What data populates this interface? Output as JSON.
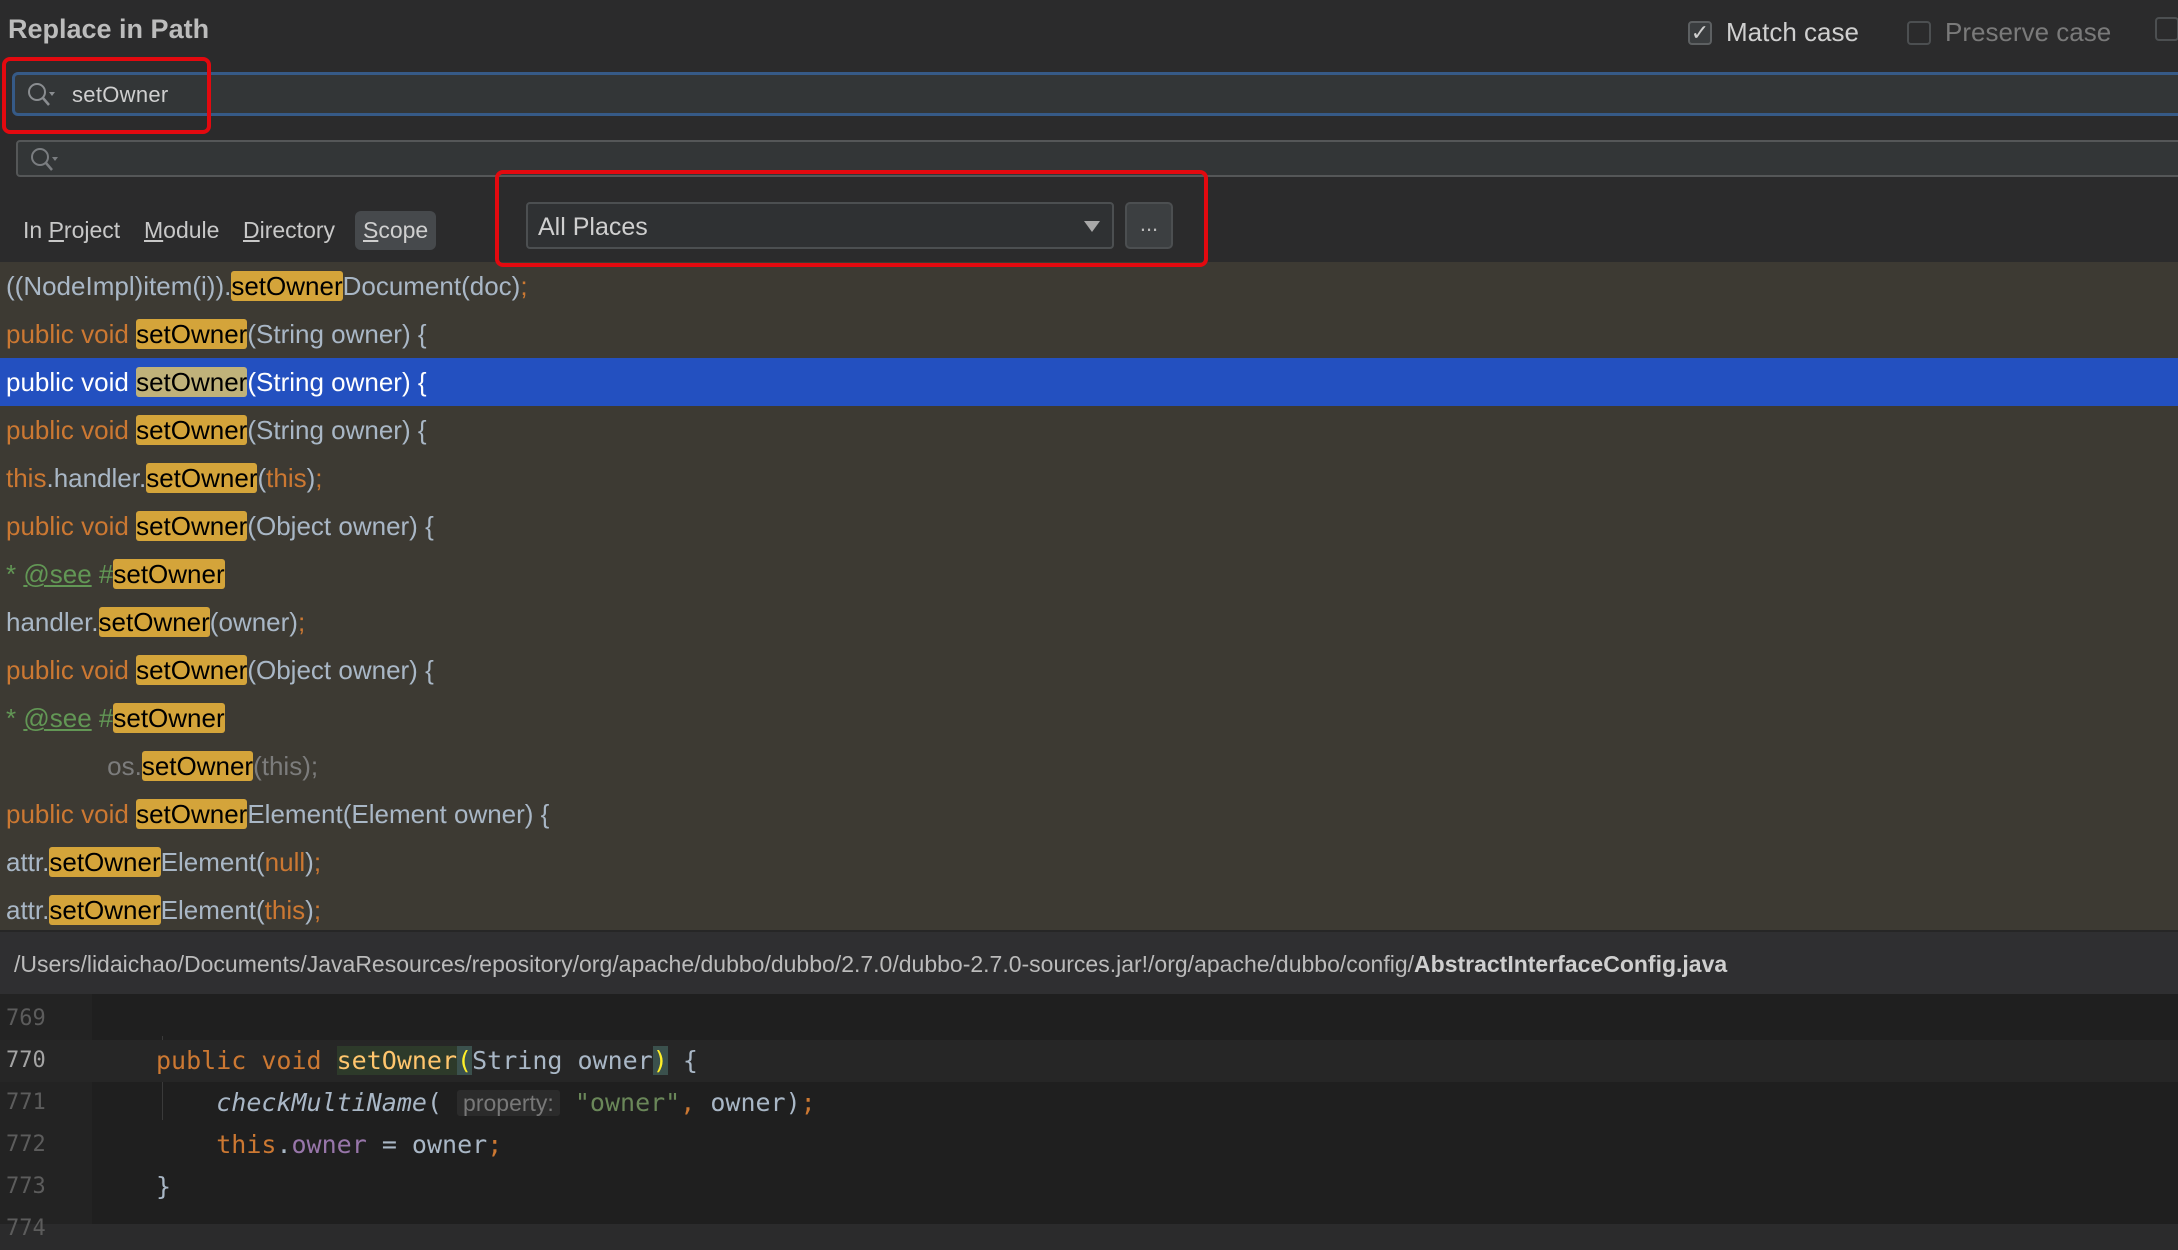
{
  "dialog": {
    "title": "Replace in Path",
    "options": {
      "match_case": {
        "label": "Match case",
        "checked": true
      },
      "preserve_case": {
        "label": "Preserve case",
        "checked": false,
        "enabled": false
      }
    }
  },
  "search": {
    "find_value": "setOwner",
    "replace_value": "",
    "find_icon": "search-history-icon",
    "replace_icon": "search-history-icon"
  },
  "scope": {
    "tabs": [
      {
        "label_pre": "In ",
        "mnemonic": "P",
        "label_post": "roject",
        "active": false
      },
      {
        "label_pre": "",
        "mnemonic": "M",
        "label_post": "odule",
        "active": false
      },
      {
        "label_pre": "",
        "mnemonic": "D",
        "label_post": "irectory",
        "active": false
      },
      {
        "label_pre": "",
        "mnemonic": "S",
        "label_post": "cope",
        "active": true
      }
    ],
    "selected": "All Places",
    "more_button": "..."
  },
  "results": {
    "selected_index": 2,
    "rows": [
      [
        {
          "t": "((NodeImpl)item(i)).",
          "c": "plain"
        },
        {
          "t": "setOwner",
          "c": "hit"
        },
        {
          "t": "Document(doc)",
          "c": "plain"
        },
        {
          "t": ";",
          "c": "kw"
        }
      ],
      [
        {
          "t": "public void ",
          "c": "kw"
        },
        {
          "t": "setOwner",
          "c": "hit"
        },
        {
          "t": "(String owner) {",
          "c": "plain"
        }
      ],
      [
        {
          "t": "public void ",
          "c": "kw"
        },
        {
          "t": "setOwner",
          "c": "hit"
        },
        {
          "t": "(String owner) {",
          "c": "plain"
        }
      ],
      [
        {
          "t": "public void ",
          "c": "kw"
        },
        {
          "t": "setOwner",
          "c": "hit"
        },
        {
          "t": "(String owner) {",
          "c": "plain"
        }
      ],
      [
        {
          "t": "this",
          "c": "kw"
        },
        {
          "t": ".handler.",
          "c": "plain"
        },
        {
          "t": "setOwner",
          "c": "hit"
        },
        {
          "t": "(",
          "c": "plain"
        },
        {
          "t": "this",
          "c": "kw"
        },
        {
          "t": ")",
          "c": "plain"
        },
        {
          "t": ";",
          "c": "kw"
        }
      ],
      [
        {
          "t": "public void ",
          "c": "kw"
        },
        {
          "t": "setOwner",
          "c": "hit"
        },
        {
          "t": "(Object owner) {",
          "c": "plain"
        }
      ],
      [
        {
          "t": "* ",
          "c": "doc"
        },
        {
          "t": "@see",
          "c": "doc-tag"
        },
        {
          "t": " #",
          "c": "doc"
        },
        {
          "t": "setOwner",
          "c": "hit"
        }
      ],
      [
        {
          "t": "handler.",
          "c": "plain"
        },
        {
          "t": "setOwner",
          "c": "hit"
        },
        {
          "t": "(owner)",
          "c": "plain"
        },
        {
          "t": ";",
          "c": "kw"
        }
      ],
      [
        {
          "t": "public void ",
          "c": "kw"
        },
        {
          "t": "setOwner",
          "c": "hit"
        },
        {
          "t": "(Object owner) {",
          "c": "plain"
        }
      ],
      [
        {
          "t": "* ",
          "c": "doc"
        },
        {
          "t": "@see",
          "c": "doc-tag"
        },
        {
          "t": " #",
          "c": "doc"
        },
        {
          "t": "setOwner",
          "c": "hit"
        }
      ],
      [
        {
          "t": "              os.",
          "c": "dim"
        },
        {
          "t": "setOwner",
          "c": "hit"
        },
        {
          "t": "(this);",
          "c": "dim"
        }
      ],
      [
        {
          "t": "public void ",
          "c": "kw"
        },
        {
          "t": "setOwner",
          "c": "hit"
        },
        {
          "t": "Element(Element owner) {",
          "c": "plain"
        }
      ],
      [
        {
          "t": "attr.",
          "c": "plain"
        },
        {
          "t": "setOwner",
          "c": "hit"
        },
        {
          "t": "Element(",
          "c": "plain"
        },
        {
          "t": "null",
          "c": "kw"
        },
        {
          "t": ")",
          "c": "plain"
        },
        {
          "t": ";",
          "c": "kw"
        }
      ],
      [
        {
          "t": "attr.",
          "c": "plain"
        },
        {
          "t": "setOwner",
          "c": "hit"
        },
        {
          "t": "Element(",
          "c": "plain"
        },
        {
          "t": "this",
          "c": "kw"
        },
        {
          "t": ")",
          "c": "plain"
        },
        {
          "t": ";",
          "c": "kw"
        }
      ]
    ]
  },
  "path_bar": {
    "dir": "/Users/lidaichao/Documents/JavaResources/repository/org/apache/dubbo/dubbo/2.7.0/dubbo-2.7.0-sources.jar!/org/apache/dubbo/config/",
    "file": "AbstractInterfaceConfig.java"
  },
  "preview": {
    "current_line": 770,
    "lines": [
      {
        "n": "769",
        "segs": []
      },
      {
        "n": "770",
        "segs": [
          {
            "t": "public ",
            "c": "c-kw"
          },
          {
            "t": "void ",
            "c": "c-kw"
          },
          {
            "t": "setOwner",
            "c": "c-fn"
          },
          {
            "t": "(",
            "c": "c-paren-match"
          },
          {
            "t": "String owner",
            "c": "plain"
          },
          {
            "t": ")",
            "c": "c-paren-match"
          },
          {
            "t": " {",
            "c": "plain"
          }
        ]
      },
      {
        "n": "771",
        "segs": [
          {
            "t": "    ",
            "c": "plain"
          },
          {
            "t": "checkMultiName",
            "c": "c-italic"
          },
          {
            "t": "( ",
            "c": "plain"
          },
          {
            "t": "property:",
            "c": "c-hint"
          },
          {
            "t": " ",
            "c": "plain"
          },
          {
            "t": "\"owner\"",
            "c": "c-str"
          },
          {
            "t": ", ",
            "c": "c-kw"
          },
          {
            "t": "owner)",
            "c": "plain"
          },
          {
            "t": ";",
            "c": "c-kw"
          }
        ]
      },
      {
        "n": "772",
        "segs": [
          {
            "t": "    ",
            "c": "plain"
          },
          {
            "t": "this",
            "c": "c-kw"
          },
          {
            "t": ".",
            "c": "plain"
          },
          {
            "t": "owner",
            "c": "c-field"
          },
          {
            "t": " = owner",
            "c": "plain"
          },
          {
            "t": ";",
            "c": "c-kw"
          }
        ]
      },
      {
        "n": "773",
        "segs": [
          {
            "t": "}",
            "c": "plain"
          }
        ]
      },
      {
        "n": "774",
        "segs": []
      }
    ]
  },
  "colors": {
    "selection": "#2350c0",
    "match_highlight": "#d4a43a",
    "results_background": "#3d3a33",
    "annotation_red": "#e3090f",
    "focus_border": "#365a87"
  }
}
